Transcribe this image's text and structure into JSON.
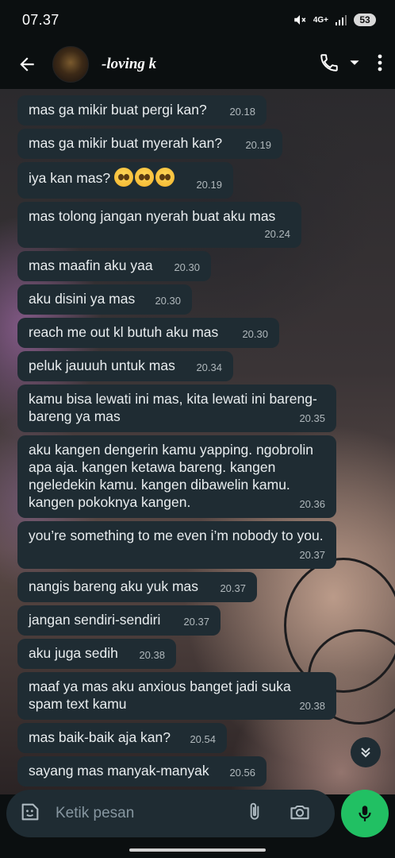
{
  "status": {
    "time": "07.37",
    "network": "4G+",
    "battery": "53"
  },
  "header": {
    "contact_name": "-loving k"
  },
  "messages": [
    {
      "text": "mas ga mikir buat pergi kan?",
      "time": "20.18"
    },
    {
      "text": "mas ga mikir buat myerah kan?",
      "time": "20.19"
    },
    {
      "text": "iya kan mas? 🥺🥺🥺",
      "time": "20.19"
    },
    {
      "text": "mas tolong jangan nyerah buat aku mas",
      "time": "20.24"
    },
    {
      "text": "mas maafin aku yaa",
      "time": "20.30"
    },
    {
      "text": "aku disini ya mas",
      "time": "20.30"
    },
    {
      "text": "reach me out kl butuh aku mas",
      "time": "20.30"
    },
    {
      "text": "peluk jauuuh untuk mas",
      "time": "20.34"
    },
    {
      "text": "kamu bisa lewati ini mas, kita lewati ini bareng-bareng ya mas",
      "time": "20.35"
    },
    {
      "text": "aku kangen dengerin kamu yapping. ngobrolin apa aja. kangen ketawa bareng. kangen ngeledekin kamu. kangen dibawelin kamu. kangen pokoknya kangen.",
      "time": "20.36"
    },
    {
      "text": "you’re something to me even i’m nobody to you.",
      "time": "20.37"
    },
    {
      "text": "nangis bareng aku yuk mas",
      "time": "20.37"
    },
    {
      "text": "jangan sendiri-sendiri",
      "time": "20.37"
    },
    {
      "text": "aku juga sedih",
      "time": "20.38"
    },
    {
      "text": "maaf ya mas aku anxious banget jadi suka spam text kamu",
      "time": "20.38"
    },
    {
      "text": "mas baik-baik aja kan?",
      "time": "20.54"
    },
    {
      "text": "sayang mas manyak-manyak",
      "time": "20.56"
    }
  ],
  "composer": {
    "placeholder": "Ketik pesan"
  },
  "colors": {
    "bubble": "#1f2c33",
    "mic": "#21c063",
    "background": "#0b0f10"
  }
}
